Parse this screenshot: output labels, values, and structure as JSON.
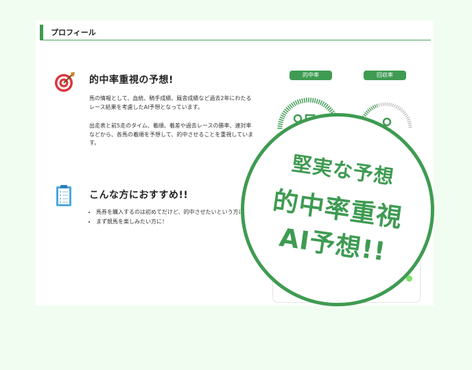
{
  "header": {
    "title": "プロフィール"
  },
  "section1": {
    "title": "的中率重視の予想!",
    "icon": "target-icon",
    "para1": "馬の情報として、血統、騎手成績、厩舎成績など過去2年にわたるレース結果を考慮したAI予想となっています。",
    "para2": "出走表と前5走のタイム、着順、着差や過去レースの勝率、連対率などから、各馬の着順を予想して、的中させることを重視しています。"
  },
  "section2": {
    "title": "こんな方におすすめ!!",
    "icon": "clipboard-icon",
    "items": [
      "馬券を購入するのは初めてだけど、的中させたいという方に！",
      "まず競馬を楽しみたい方に！"
    ]
  },
  "stats": {
    "hit_rate_label": "的中率",
    "return_rate_label": "回収率"
  },
  "slogan": {
    "line1": "堅実な予想",
    "line2": "的中率重視",
    "line3": "AI予想!!"
  },
  "colors": {
    "accent": "#3f9b52",
    "background": "#f2fdf2"
  }
}
